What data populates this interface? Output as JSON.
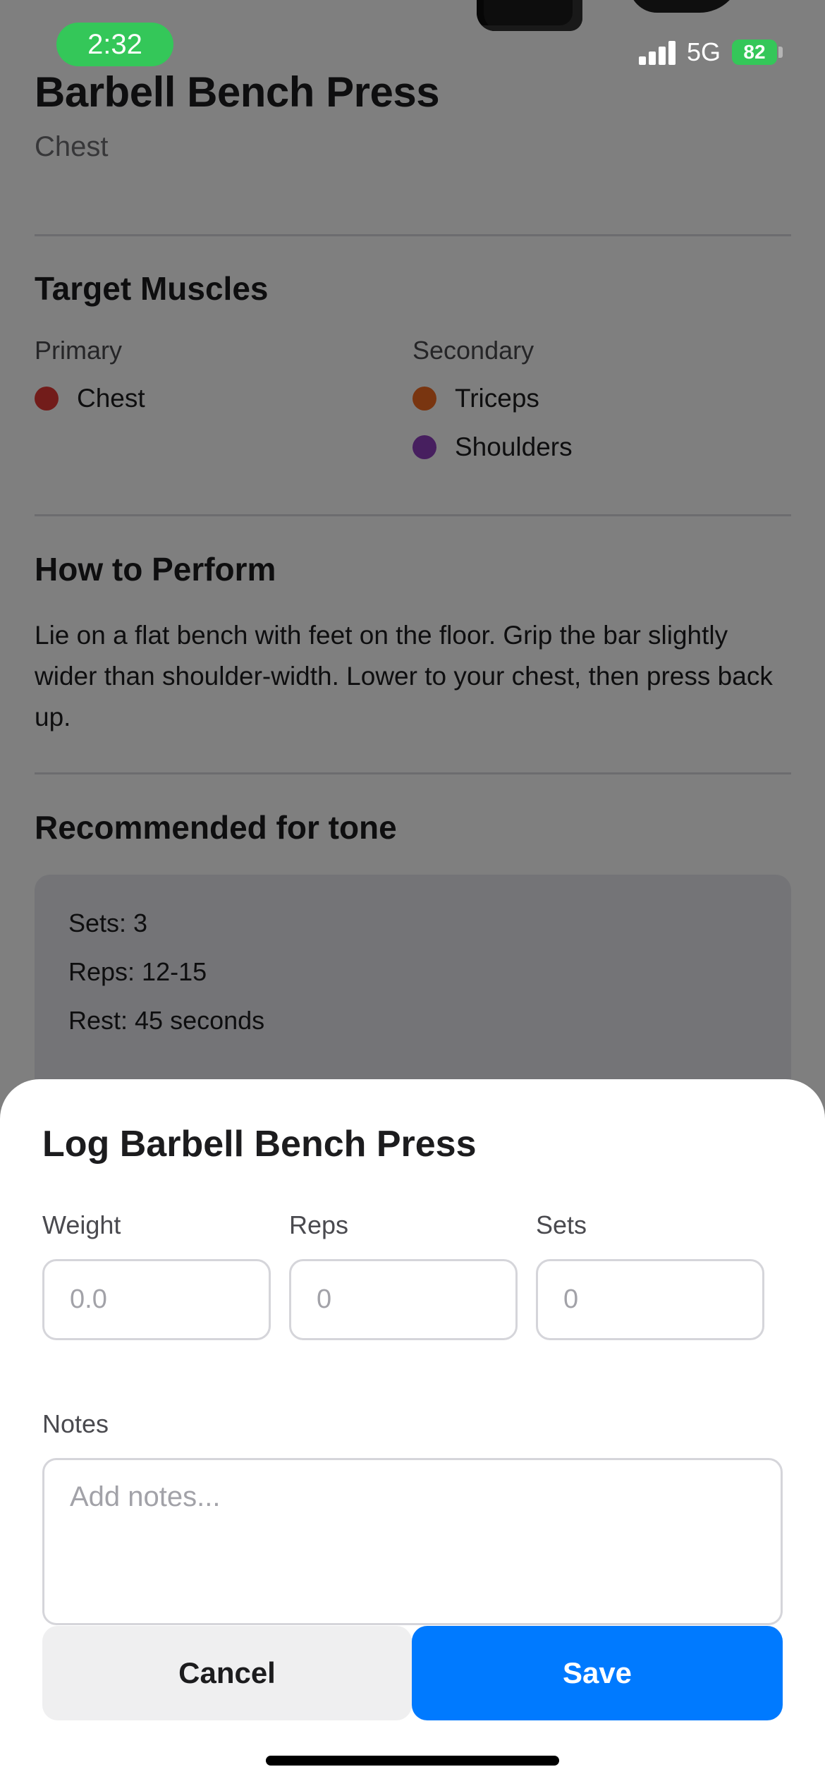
{
  "status_bar": {
    "time": "2:32",
    "network": "5G",
    "battery": "82"
  },
  "exercise": {
    "title": "Barbell Bench Press",
    "category": "Chest"
  },
  "target_muscles": {
    "heading": "Target Muscles",
    "primary_label": "Primary",
    "secondary_label": "Secondary",
    "primary": [
      {
        "name": "Chest",
        "color": "#e53935"
      }
    ],
    "secondary": [
      {
        "name": "Triceps",
        "color": "#f26b21"
      },
      {
        "name": "Shoulders",
        "color": "#8e3fbf"
      }
    ]
  },
  "how_to": {
    "heading": "How to Perform",
    "text": "Lie on a flat bench with feet on the floor. Grip the bar slightly wider than shoulder-width. Lower to your chest, then press back up."
  },
  "recommended": {
    "heading": "Recommended for tone",
    "sets": "Sets: 3",
    "reps": "Reps: 12-15",
    "rest": "Rest: 45 seconds"
  },
  "log_sheet": {
    "title": "Log Barbell Bench Press",
    "weight_label": "Weight",
    "weight_placeholder": "0.0",
    "reps_label": "Reps",
    "reps_placeholder": "0",
    "sets_label": "Sets",
    "sets_placeholder": "0",
    "notes_label": "Notes",
    "notes_placeholder": "Add notes...",
    "cancel_label": "Cancel",
    "save_label": "Save"
  },
  "colors": {
    "accent": "#007aff",
    "status_green": "#34c759"
  }
}
